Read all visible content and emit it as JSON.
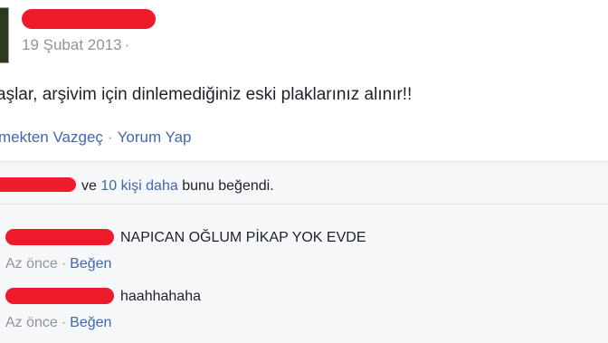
{
  "post": {
    "date": "19 Şubat 2013",
    "date_separator": "·",
    "text": "aşlar, arşivim için dinlemediğiniz eski plaklarınız alınır!!",
    "actions": {
      "unfollow": "mekten Vazgeç",
      "separator": "·",
      "comment": "Yorum Yap"
    }
  },
  "likes": {
    "connector": "ve",
    "others_link": "10 kişi daha",
    "suffix": "bunu beğendi."
  },
  "comments": [
    {
      "text": "NAPICAN OĞLUM PİKAP YOK EVDE",
      "time": "Az önce",
      "separator": "·",
      "like_label": "Beğen"
    },
    {
      "text": "haahhahaha",
      "time": "Az önce",
      "separator": "·",
      "like_label": "Beğen"
    }
  ],
  "colors": {
    "redaction": "#ee1b2a",
    "link": "#4267b2",
    "meta_text": "#90949c",
    "ufi_background": "#f6f7f9"
  }
}
